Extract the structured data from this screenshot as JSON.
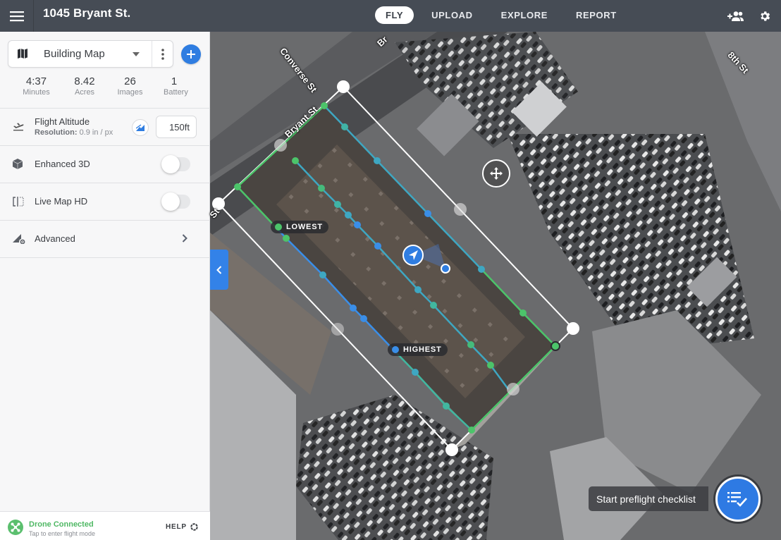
{
  "header": {
    "title": "1045 Bryant St.",
    "tabs": [
      {
        "label": "FLY",
        "active": true
      },
      {
        "label": "UPLOAD",
        "active": false
      },
      {
        "label": "EXPLORE",
        "active": false
      },
      {
        "label": "REPORT",
        "active": false
      }
    ],
    "icons": [
      "menu-icon",
      "add-team-member-icon",
      "settings-gear-icon"
    ]
  },
  "sidebar": {
    "map_selector": {
      "icon": "map-icon",
      "label": "Building Map"
    },
    "stats": [
      {
        "value": "4:37",
        "label": "Minutes"
      },
      {
        "value": "8.42",
        "label": "Acres"
      },
      {
        "value": "26",
        "label": "Images"
      },
      {
        "value": "1",
        "label": "Battery"
      }
    ],
    "flight_altitude": {
      "label": "Flight Altitude",
      "resolution_label": "Resolution:",
      "resolution_value": "0.9 in / px",
      "value": "150ft"
    },
    "enhanced_3d": {
      "label": "Enhanced 3D",
      "enabled": false
    },
    "live_map_hd": {
      "label": "Live Map HD",
      "enabled": false
    },
    "advanced": {
      "label": "Advanced"
    }
  },
  "status": {
    "title": "Drone Connected",
    "subtitle": "Tap to enter flight mode",
    "help_label": "HELP"
  },
  "map": {
    "street_labels": [
      "Bryant St",
      "Converse St",
      "8th St",
      "Br",
      "St"
    ],
    "markers": {
      "lowest": "LOWEST",
      "highest": "HIGHEST"
    },
    "colors": {
      "boundary": "#ffffff",
      "path_start": "#4cc46a",
      "path_end": "#3a8ee8",
      "accent": "#2f7de1"
    },
    "preflight_tooltip": "Start preflight checklist"
  }
}
